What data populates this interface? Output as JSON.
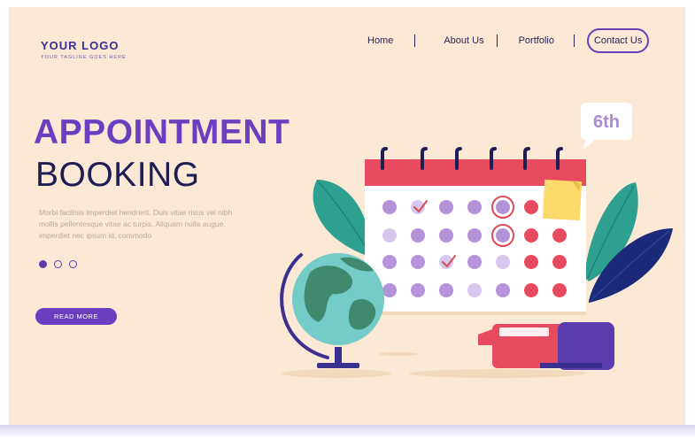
{
  "logo": {
    "title": "YOUR LOGO",
    "tagline": "YOUR TAGLINE GOES HERE"
  },
  "nav": {
    "items": [
      "Home",
      "About Us",
      "Portfolio"
    ],
    "contact": "Contact Us"
  },
  "hero": {
    "line1": "APPOINTMENT",
    "line2": "BOOKING",
    "description": "Morbi facilisis imperdiet hendrerit. Duis vitae risus vel nibh mollis pellentesque vitae ac turpis. Aliquam nulla augue, imperdiet nec ipsum id, commodo",
    "read_more": "READ MORE"
  },
  "slider": {
    "active_index": 0,
    "count": 3
  },
  "calendar": {
    "bubble": "6th"
  },
  "colors": {
    "background": "#fbe8d5",
    "accent": "#6a3fbf",
    "navy": "#1f1d55",
    "calendar_red": "#e84a5f",
    "dot_purple": "#b293d8",
    "globe_teal": "#74cbc7",
    "leaf_green": "#2ea08f"
  }
}
